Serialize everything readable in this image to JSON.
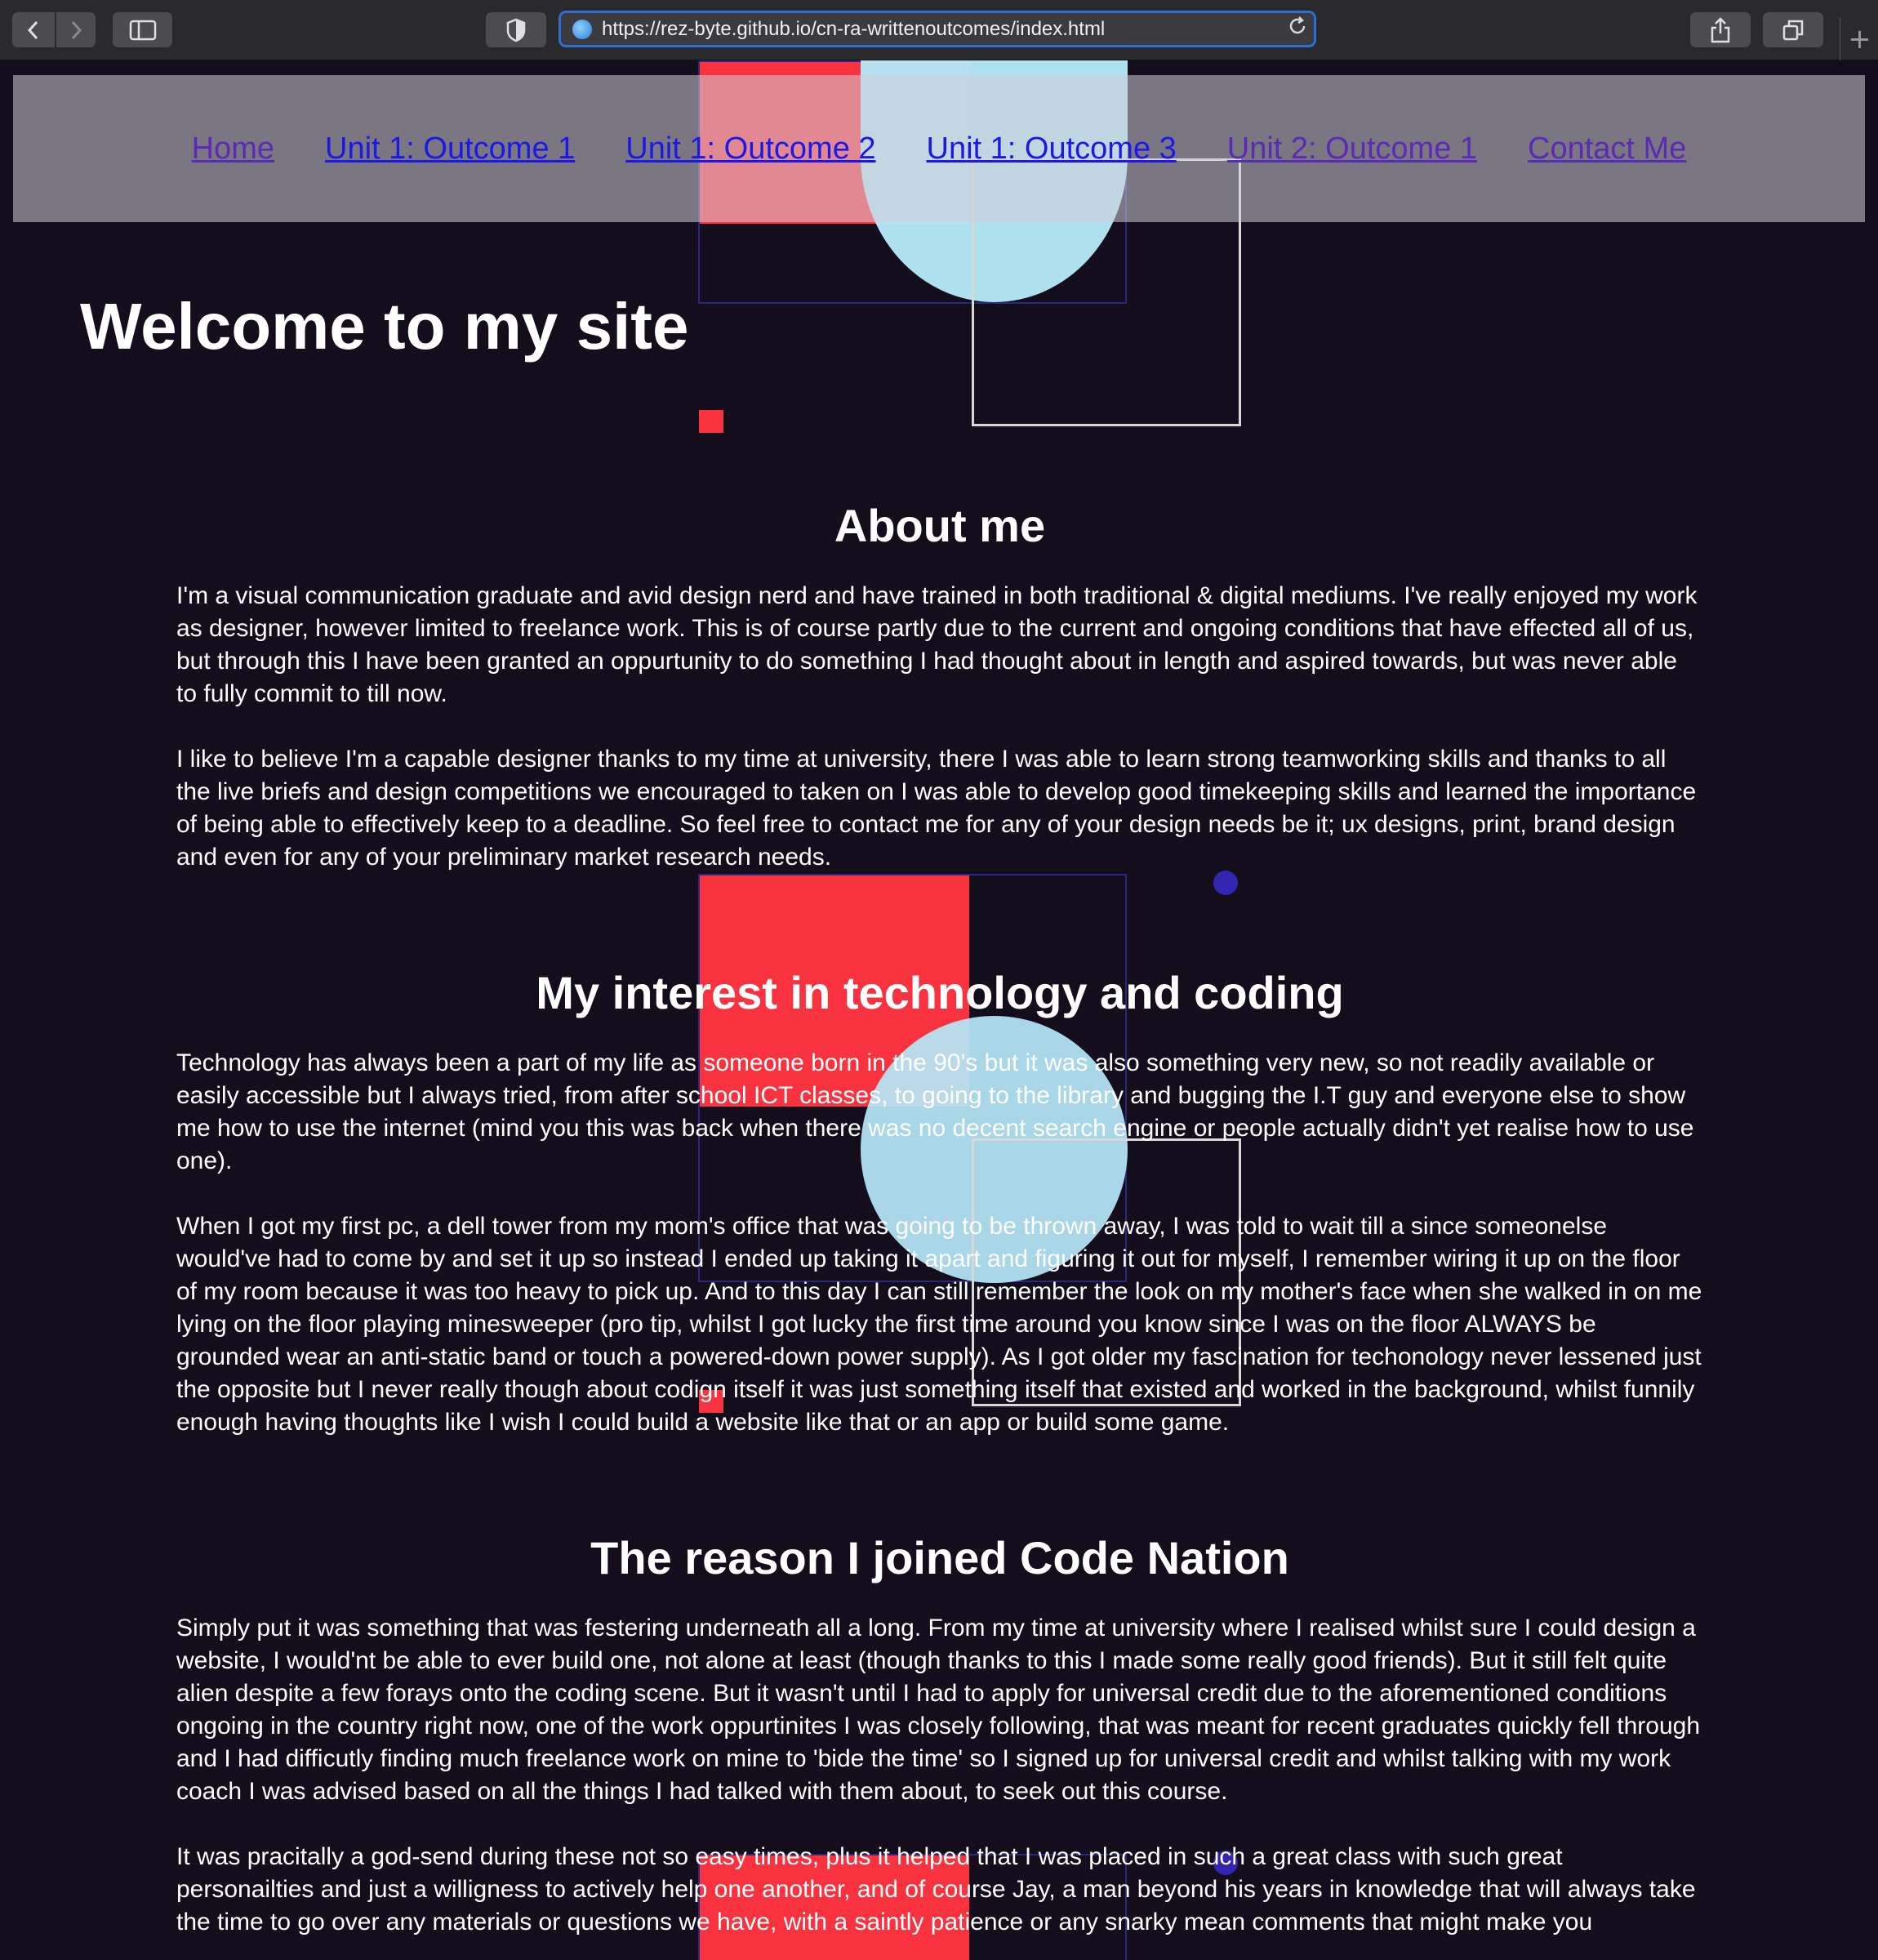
{
  "browser": {
    "url": "https://rez-byte.github.io/cn-ra-writtenoutcomes/index.html",
    "icons": {
      "back": "chevron-left-icon",
      "forward": "chevron-right-icon",
      "sidebar": "sidebar-icon",
      "privacy": "shield-icon",
      "site": "globe-icon",
      "reload": "reload-icon",
      "share": "share-icon",
      "tabs": "tabs-overview-icon",
      "new_tab": "plus-icon"
    }
  },
  "nav": {
    "links": [
      {
        "label": "Home"
      },
      {
        "label": "Unit 1: Outcome 1"
      },
      {
        "label": "Unit 1: Outcome 2"
      },
      {
        "label": "Unit 1: Outcome 3"
      },
      {
        "label": "Unit 2: Outcome 1"
      },
      {
        "label": "Contact Me"
      }
    ]
  },
  "page": {
    "title": "Welcome to my site",
    "sections": [
      {
        "title": "About me",
        "paragraphs": [
          "I'm a visual communication graduate and avid design nerd and have trained in both traditional & digital mediums. I've really enjoyed my work as designer, however limited to freelance work. This is of course partly due to the current and ongoing conditions that have effected all of us, but through this I have been granted an oppurtunity to do something I had thought about in length and aspired towards, but was never able to fully commit to till now.",
          "I like to believe I'm a capable designer thanks to my time at university, there I was able to learn strong teamworking skills and thanks to all the live briefs and design competitions we encouraged to taken on I was able to develop good timekeeping skills and learned the importance of being able to effectively keep to a deadline. So feel free to contact me for any of your design needs be it; ux designs, print, brand design and even for any of your preliminary market research needs."
        ]
      },
      {
        "title": "My interest in technology and coding",
        "paragraphs": [
          "Technology has always been a part of my life as someone born in the 90's but it was also something very new, so not readily available or easily accessible but I always tried, from after school ICT classes, to going to the library and bugging the I.T guy and everyone else to show me how to use the internet (mind you this was back when there was no decent search engine or people actually didn't yet realise how to use one).",
          "When I got my first pc, a dell tower from my mom's office that was going to be thrown away, I was told to wait till a since someonelse would've had to come by and set it up so instead I ended up taking it apart and figuring it out for myself, I remember wiring it up on the floor of my room because it was too heavy to pick up. And to this day I can still remember the look on my mother's face when she walked in on me lying on the floor playing minesweeper (pro tip, whilst I got lucky the first time around you know since I was on the floor ALWAYS be grounded wear an anti-static band or touch a powered-down power supply). As I got older my fascination for techonology never lessened just the opposite but I never really though about codign itself it was just something itself that existed and worked in the background, whilst funnily enough having thoughts like I wish I could build a website like that or an app or build some game."
        ]
      },
      {
        "title": "The reason I joined Code Nation",
        "paragraphs": [
          "Simply put it was something that was festering underneath all a long. From my time at university where I realised whilst sure I could design a website, I would'nt be able to ever build one, not alone at least (though thanks to this I made some really good friends). But it still felt quite alien despite a few forays onto the coding scene. But it wasn't until I had to apply for universal credit due to the aforementioned conditions ongoing in the country right now, one of the work oppurtinites I was closely following, that was meant for recent graduates quickly fell through and I had difficutly finding much freelance work on mine to 'bide the time' so I signed up for universal credit and whilst talking with my work coach I was advised based on all the things I had talked with them about, to seek out this course.",
          "It was pracitally a god-send during these not so easy times, plus it helped that I was placed in such a great class with such great personailties and just a willigness to actively help one another, and of course Jay, a man beyond his years in knowledge that will always take the time to go over any materials or questions we have, with a saintly patience or any snarky mean comments that might make you"
        ]
      }
    ]
  },
  "colors": {
    "background": "#140d1c",
    "accent_red": "#f8333f",
    "accent_circle": "#b5e7f6",
    "accent_blue": "#3226b0",
    "nav_visited": "#5a2bb5",
    "nav_link": "#1b18e8"
  }
}
